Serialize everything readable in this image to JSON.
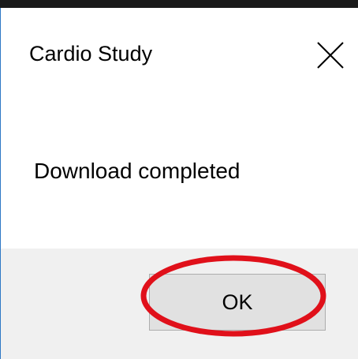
{
  "dialog": {
    "title": "Cardio Study",
    "message": "Download completed",
    "close_icon": "close-icon",
    "ok_label": "OK"
  },
  "annotation": {
    "shape": "ellipse",
    "color": "#e0101a"
  },
  "colors": {
    "button_area_bg": "#f0f0f0",
    "button_bg": "#e1e1e1",
    "button_border": "#adadad",
    "window_border": "#2e78c6"
  }
}
